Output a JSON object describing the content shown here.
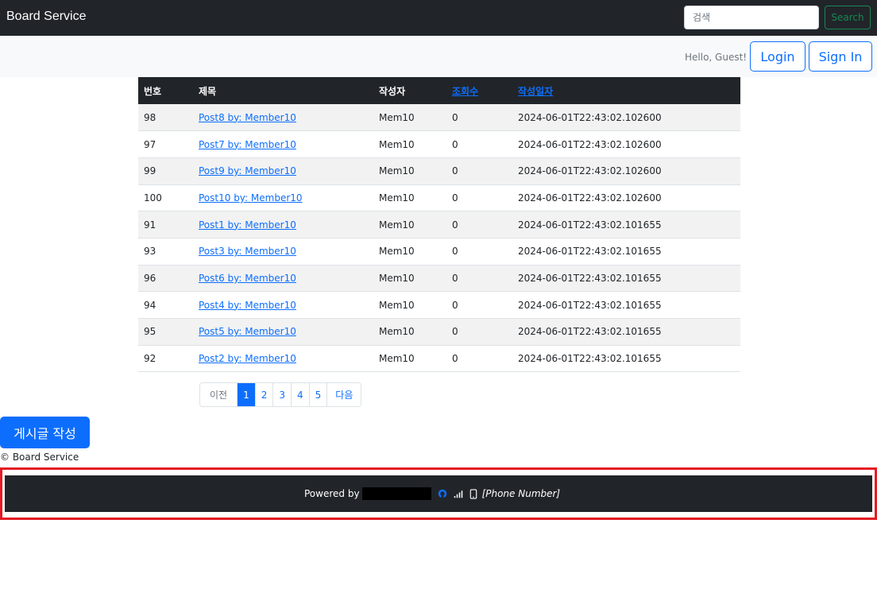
{
  "nav": {
    "brand": "Board Service",
    "search_placeholder": "검색",
    "search_button": "Search"
  },
  "subbar": {
    "greeting": "Hello, Guest!",
    "login": "Login",
    "signin": "Sign In"
  },
  "table": {
    "headers": {
      "no": "번호",
      "title": "제목",
      "author": "작성자",
      "views": "조회수",
      "date": "작성일자"
    },
    "rows": [
      {
        "no": "98",
        "title": "Post8 by: Member10",
        "author": "Mem10",
        "views": "0",
        "date": "2024-06-01T22:43:02.102600"
      },
      {
        "no": "97",
        "title": "Post7 by: Member10",
        "author": "Mem10",
        "views": "0",
        "date": "2024-06-01T22:43:02.102600"
      },
      {
        "no": "99",
        "title": "Post9 by: Member10",
        "author": "Mem10",
        "views": "0",
        "date": "2024-06-01T22:43:02.102600"
      },
      {
        "no": "100",
        "title": "Post10 by: Member10",
        "author": "Mem10",
        "views": "0",
        "date": "2024-06-01T22:43:02.102600"
      },
      {
        "no": "91",
        "title": "Post1 by: Member10",
        "author": "Mem10",
        "views": "0",
        "date": "2024-06-01T22:43:02.101655"
      },
      {
        "no": "93",
        "title": "Post3 by: Member10",
        "author": "Mem10",
        "views": "0",
        "date": "2024-06-01T22:43:02.101655"
      },
      {
        "no": "96",
        "title": "Post6 by: Member10",
        "author": "Mem10",
        "views": "0",
        "date": "2024-06-01T22:43:02.101655"
      },
      {
        "no": "94",
        "title": "Post4 by: Member10",
        "author": "Mem10",
        "views": "0",
        "date": "2024-06-01T22:43:02.101655"
      },
      {
        "no": "95",
        "title": "Post5 by: Member10",
        "author": "Mem10",
        "views": "0",
        "date": "2024-06-01T22:43:02.101655"
      },
      {
        "no": "92",
        "title": "Post2 by: Member10",
        "author": "Mem10",
        "views": "0",
        "date": "2024-06-01T22:43:02.101655"
      }
    ]
  },
  "pagination": {
    "prev": "이전",
    "pages": [
      "1",
      "2",
      "3",
      "4",
      "5"
    ],
    "active": "1",
    "next": "다음"
  },
  "write_button": "게시글 작성",
  "copyright": "© Board Service",
  "footer": {
    "powered_by": "Powered by",
    "phone": "[Phone Number]",
    "icons": [
      "github-icon",
      "signal-icon",
      "phone-icon"
    ]
  },
  "colors": {
    "dark": "#212529",
    "primary": "#0d6efd",
    "success": "#198754",
    "highlight_frame": "#e31b23"
  }
}
